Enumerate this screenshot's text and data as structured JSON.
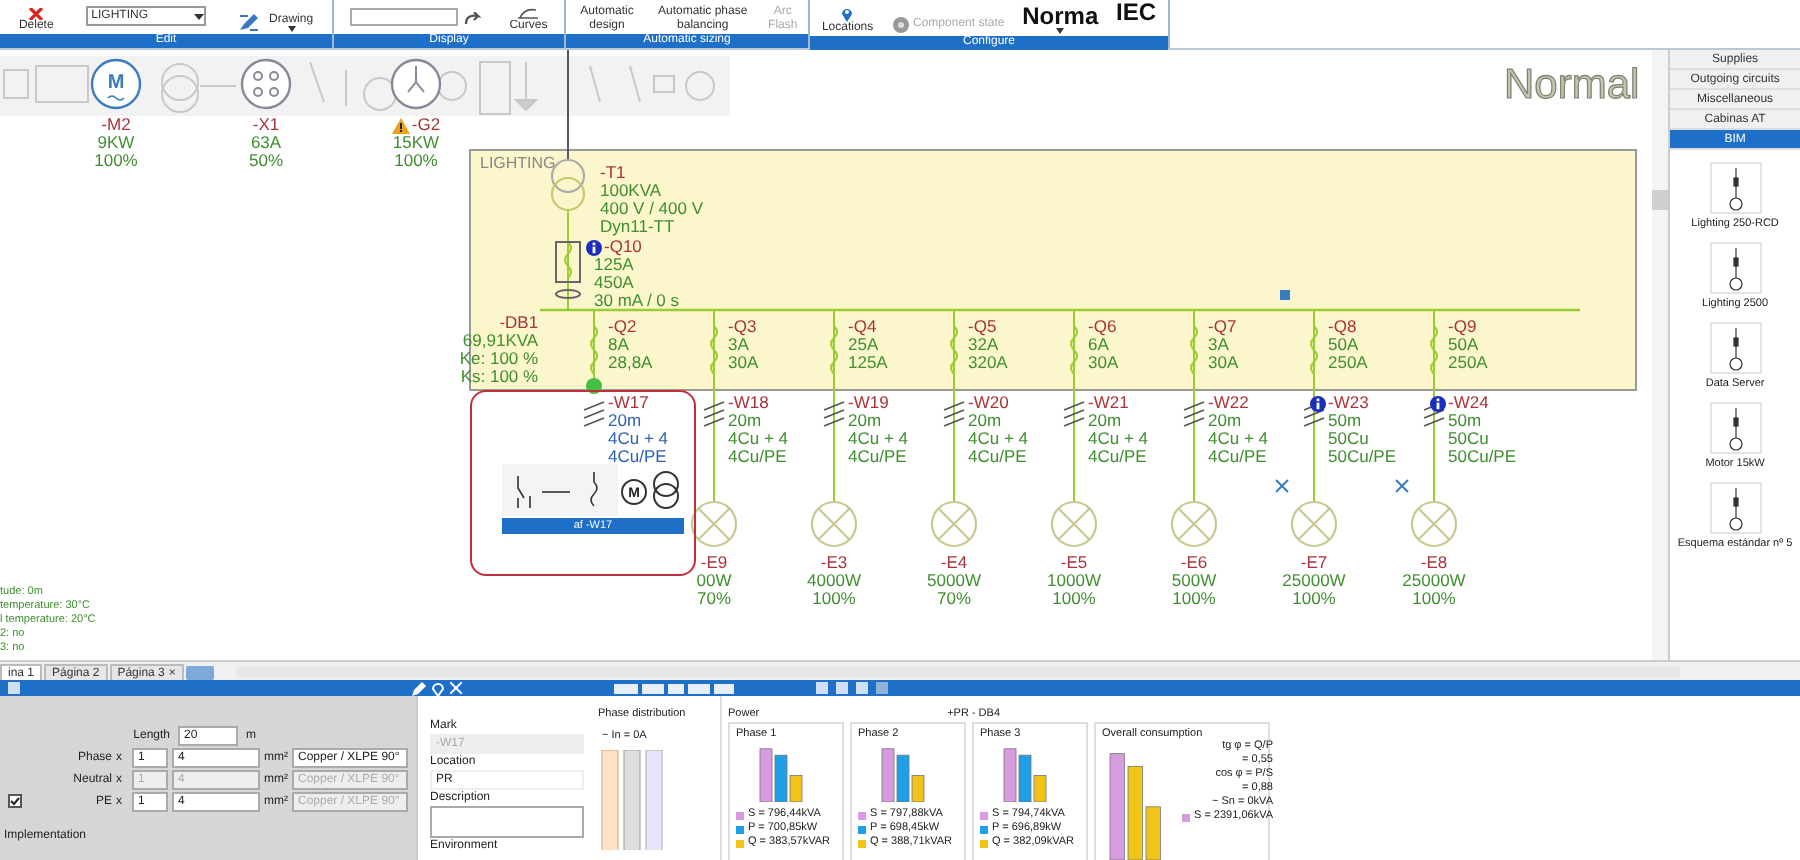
{
  "ribbon": {
    "groups": [
      {
        "label": "Edit",
        "buttons": [
          {
            "kind": "button",
            "label": "Delete",
            "disabled": false
          },
          {
            "kind": "dropdown",
            "label": "LIGHTING",
            "disabled": false
          },
          {
            "kind": "menu",
            "label": "Drawing",
            "disabled": false
          }
        ]
      },
      {
        "label": "Display",
        "buttons": [
          {
            "kind": "field",
            "disabled": false
          },
          {
            "kind": "button",
            "label": "Curves",
            "disabled": false
          }
        ]
      },
      {
        "label": "Automatic sizing",
        "buttons": [
          {
            "kind": "button",
            "label": "Automatic design",
            "disabled": false
          },
          {
            "kind": "button",
            "label": "Automatic phase balancing",
            "disabled": false
          },
          {
            "kind": "button",
            "label": "Arc Flash",
            "disabled": true
          }
        ]
      },
      {
        "label": "Configure",
        "buttons": [
          {
            "kind": "button",
            "label": "Locations",
            "disabled": false
          },
          {
            "kind": "button",
            "label": "Component state",
            "disabled": true
          },
          {
            "kind": "bigmenu",
            "label": "Norma",
            "disabled": false
          },
          {
            "kind": "big",
            "label": "IEC",
            "disabled": false
          }
        ]
      }
    ]
  },
  "palette": [
    {
      "kind": "motor",
      "symbol": "M",
      "mark": "-M2",
      "ratings": [
        "9KW",
        "100%"
      ],
      "warning": false
    },
    {
      "kind": "socket",
      "mark": "-X1",
      "ratings": [
        "63A",
        "50%"
      ],
      "warning": false
    },
    {
      "kind": "generator",
      "mark": "-G2",
      "ratings": [
        "15KW",
        "100%"
      ],
      "warning": true
    }
  ],
  "view_mode": "Normal",
  "board": {
    "name": "LIGHTING",
    "transformer": {
      "mark": "-T1",
      "specs": [
        "100KVA",
        "400 V / 400 V",
        "Dyn11-TT"
      ]
    },
    "main_breaker": {
      "mark": "-Q10",
      "specs": [
        "125A",
        "450A",
        "30 mA / 0 s"
      ],
      "info": true
    },
    "panel": {
      "mark": "-DB1",
      "specs": [
        "69,91KVA",
        "Ke: 100 %",
        "Ks: 100 %"
      ]
    },
    "circuits": [
      {
        "kind": "preview",
        "breaker": "-Q2",
        "ratings": [
          "8A",
          "28,8A"
        ],
        "cable": "-W17",
        "cable_specs": [
          "20m",
          "4Cu + 4",
          "4Cu/PE"
        ],
        "info": false,
        "selected": true,
        "motor_symbol": "M",
        "preview": "af -W17"
      },
      {
        "kind": "lamp",
        "breaker": "-Q3",
        "ratings": [
          "3A",
          "30A"
        ],
        "cable": "-W18",
        "cable_specs": [
          "20m",
          "4Cu + 4",
          "4Cu/PE"
        ],
        "info": false,
        "selected": false,
        "load": "-E9",
        "load_specs": [
          "00W",
          "70%"
        ]
      },
      {
        "kind": "lamp",
        "breaker": "-Q4",
        "ratings": [
          "25A",
          "125A"
        ],
        "cable": "-W19",
        "cable_specs": [
          "20m",
          "4Cu + 4",
          "4Cu/PE"
        ],
        "info": false,
        "selected": false,
        "load": "-E3",
        "load_specs": [
          "4000W",
          "100%"
        ]
      },
      {
        "kind": "lamp",
        "breaker": "-Q5",
        "ratings": [
          "32A",
          "320A"
        ],
        "cable": "-W20",
        "cable_specs": [
          "20m",
          "4Cu + 4",
          "4Cu/PE"
        ],
        "info": false,
        "selected": false,
        "load": "-E4",
        "load_specs": [
          "5000W",
          "70%"
        ]
      },
      {
        "kind": "lamp",
        "breaker": "-Q6",
        "ratings": [
          "6A",
          "30A"
        ],
        "cable": "-W21",
        "cable_specs": [
          "20m",
          "4Cu + 4",
          "4Cu/PE"
        ],
        "info": false,
        "selected": false,
        "load": "-E5",
        "load_specs": [
          "1000W",
          "100%"
        ]
      },
      {
        "kind": "lamp",
        "breaker": "-Q7",
        "ratings": [
          "3A",
          "30A"
        ],
        "cable": "-W22",
        "cable_specs": [
          "20m",
          "4Cu + 4",
          "4Cu/PE"
        ],
        "info": false,
        "selected": false,
        "load": "-E6",
        "load_specs": [
          "500W",
          "100%"
        ]
      },
      {
        "kind": "lamp",
        "breaker": "-Q8",
        "ratings": [
          "50A",
          "250A"
        ],
        "cable": "-W23",
        "cable_specs": [
          "50m",
          "50Cu",
          "50Cu/PE"
        ],
        "info": true,
        "selected": false,
        "load": "-E7",
        "load_specs": [
          "25000W",
          "100%"
        ]
      },
      {
        "kind": "lamp",
        "breaker": "-Q9",
        "ratings": [
          "50A",
          "250A"
        ],
        "cable": "-W24",
        "cable_specs": [
          "50m",
          "50Cu",
          "50Cu/PE"
        ],
        "info": true,
        "selected": false,
        "load": "-E8",
        "load_specs": [
          "25000W",
          "100%"
        ]
      }
    ]
  },
  "environment_notes": [
    "tude: 0m",
    "temperature: 30°C",
    "l temperature: 20°C",
    "2: no",
    "3: no"
  ],
  "page_tabs": [
    {
      "label": "ina 1",
      "selected": true
    },
    {
      "label": "Página 2",
      "selected": false
    },
    {
      "label": "Página 3",
      "selected": false,
      "close": "×"
    }
  ],
  "library": {
    "tabs": [
      {
        "label": "Supplies",
        "selected": false
      },
      {
        "label": "Outgoing circuits",
        "selected": false
      },
      {
        "label": "Miscellaneous",
        "selected": false
      },
      {
        "label": "Cabinas AT",
        "selected": false
      },
      {
        "label": "BIM",
        "selected": true
      }
    ],
    "items": [
      "Lighting 250-RCD",
      "Lighting 2500",
      "Data Server",
      "Motor 15kW",
      "Esquema estándar nº 5"
    ]
  },
  "cable_editor": {
    "length": {
      "label": "Length",
      "value": "20",
      "unit": "m"
    },
    "conductors": [
      {
        "label": "Phase",
        "times": "x",
        "count": "1",
        "section": "4",
        "unit": "mm²",
        "material": "Copper / XLPE 90°",
        "kind": "plain",
        "disabled": false,
        "material_disabled": false
      },
      {
        "label": "Neutral",
        "times": "x",
        "count": "1",
        "section": "4",
        "unit": "mm²",
        "material": "Copper / XLPE 90°",
        "kind": "plain",
        "disabled": true,
        "material_disabled": true
      },
      {
        "label": "PE",
        "times": "x",
        "count": "1",
        "section": "4",
        "unit": "mm²",
        "material": "Copper / XLPE 90°",
        "kind": "checkbox",
        "checked": true,
        "disabled": false,
        "material_disabled": true
      }
    ],
    "implementation": "Implementation"
  },
  "properties": [
    {
      "kind": "text",
      "label": "Mark",
      "value": "-W17",
      "disabled": true
    },
    {
      "kind": "text",
      "label": "Location",
      "value": "PR",
      "disabled": false
    },
    {
      "kind": "textarea",
      "label": "Description"
    },
    {
      "kind": "heading",
      "label": "Environment"
    }
  ],
  "phase_distribution": {
    "title": "Phase distribution",
    "reading": "~ In = 0A"
  },
  "power": {
    "title": "Power",
    "board": "+PR - DB4",
    "phases": [
      {
        "title": "Phase 1",
        "lines": [
          {
            "text": "S = 796,44kVA",
            "color": "#d79be0"
          },
          {
            "text": "P = 700,85kW",
            "color": "#1ea0e6"
          },
          {
            "text": "Q = 383,57kVAR",
            "color": "#f0c419"
          }
        ]
      },
      {
        "title": "Phase 2",
        "lines": [
          {
            "text": "S = 797,88kVA",
            "color": "#d79be0"
          },
          {
            "text": "P = 698,45kW",
            "color": "#1ea0e6"
          },
          {
            "text": "Q = 388,71kVAR",
            "color": "#f0c419"
          }
        ]
      },
      {
        "title": "Phase 3",
        "lines": [
          {
            "text": "S = 794,74kVA",
            "color": "#d79be0"
          },
          {
            "text": "P = 696,89kW",
            "color": "#1ea0e6"
          },
          {
            "text": "Q = 382,09kVAR",
            "color": "#f0c419"
          }
        ]
      }
    ],
    "overall": {
      "title": "Overall consumption",
      "formulas": [
        "tg φ = Q/P",
        "= 0,55",
        "cos φ = P/S",
        "= 0,88",
        "~ Sn = 0kVA"
      ],
      "lines": [
        {
          "text": "S = 2391,06kVA",
          "color": "#d79be0"
        }
      ]
    }
  }
}
